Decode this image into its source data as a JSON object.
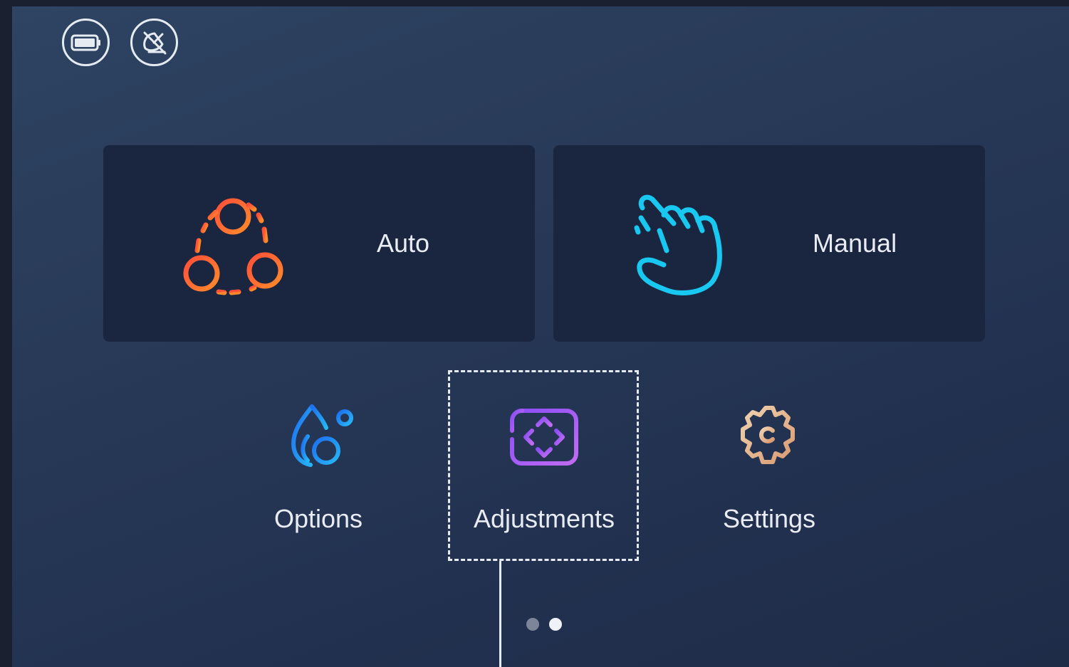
{
  "status_icons": [
    {
      "name": "battery-icon"
    },
    {
      "name": "satellite-off-icon"
    }
  ],
  "modes": {
    "auto": {
      "label": "Auto",
      "icon": "auto-cycle-icon",
      "color": "#ff6a3d"
    },
    "manual": {
      "label": "Manual",
      "icon": "hand-tap-icon",
      "color": "#19c8f0"
    }
  },
  "tiles": {
    "options": {
      "label": "Options",
      "icon": "drops-icon",
      "color": "#2aa3f0"
    },
    "adjustments": {
      "label": "Adjustments",
      "icon": "adjust-arrows-icon",
      "color": "#9b5cf6"
    },
    "settings": {
      "label": "Settings",
      "icon": "gear-icon",
      "color": "#e8b894"
    }
  },
  "pager": {
    "pages": 2,
    "active_index": 1
  },
  "colors": {
    "background": "#283a58",
    "card": "#1a2540",
    "text": "#e9edf3"
  }
}
